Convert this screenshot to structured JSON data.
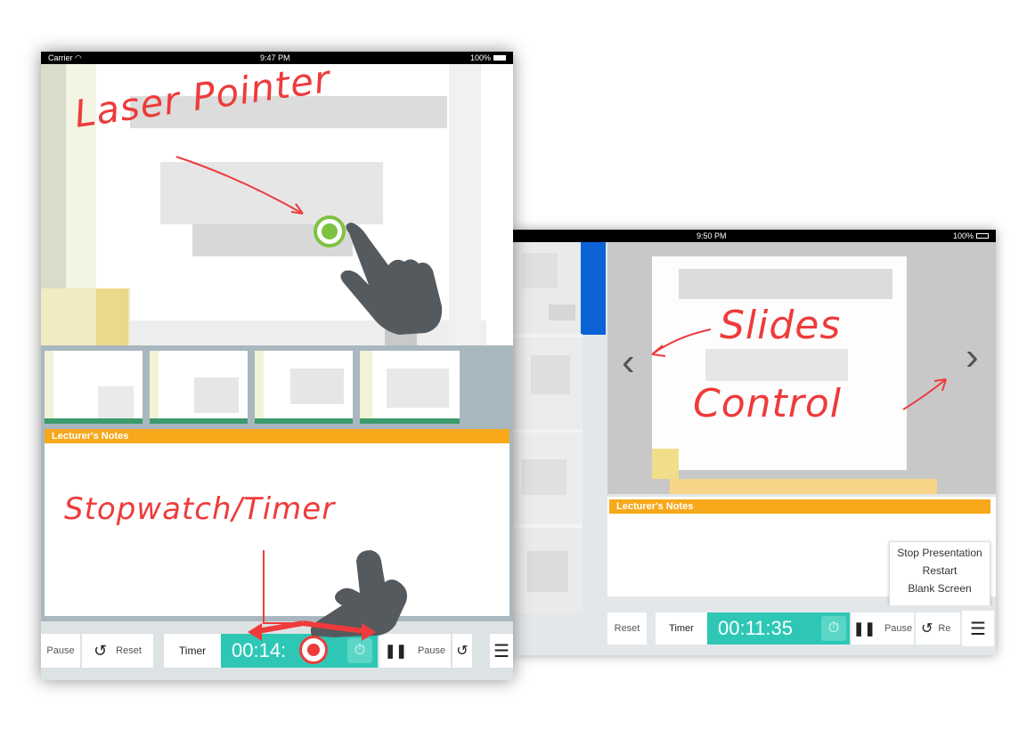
{
  "left_device": {
    "status": {
      "carrier": "Carrier",
      "time": "9:47 PM",
      "battery": "100%"
    },
    "annotations": {
      "laser": "Laser Pointer",
      "stopwatch": "Stopwatch/Timer"
    },
    "notes_title": "Lecturer's Notes",
    "toolbar": {
      "pause_left": "Pause",
      "reset": "Reset",
      "timer_tab": "Timer",
      "timer_value": "00:14:",
      "pause": "Pause"
    }
  },
  "right_device": {
    "status": {
      "time": "9:50 PM",
      "battery": "100%"
    },
    "annotations": {
      "slides": "Slides",
      "control": "Control"
    },
    "notes_title": "Lecturer's Notes",
    "menu": [
      "Stop Presentation",
      "Restart",
      "Blank Screen"
    ],
    "toolbar": {
      "reset": "Reset",
      "timer_tab": "Timer",
      "timer_value": "00:11:35",
      "pause": "Pause",
      "reset_cut": "Re"
    }
  },
  "colors": {
    "accent_teal": "#2ec7b6",
    "notes_orange": "#f7a81b",
    "annotation_red": "#ee3b3b"
  }
}
